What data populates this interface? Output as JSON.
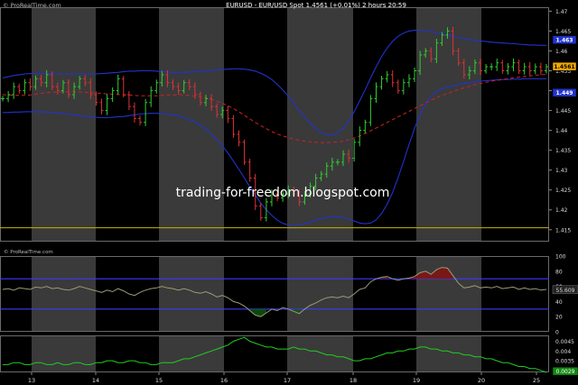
{
  "header": {
    "source_label": "© ProRealTime.com",
    "title": "EURUSD - EUR/USD Spot    1.4561 (+0.01%)    2 hours  20:59"
  },
  "watermark": "trading-for-freedom.blogspot.com",
  "price_axis": {
    "ticks": [
      "1.47",
      "1.465",
      "1.46",
      "1.455",
      "1.45",
      "1.445",
      "1.44",
      "1.435",
      "1.43",
      "1.425",
      "1.42",
      "1.415"
    ],
    "last_price": "1.4561",
    "upper_band_label": "1.463",
    "lower_band_label": "1.449"
  },
  "rsi_axis": {
    "ticks": [
      "100",
      "80",
      "60",
      "40",
      "20",
      "0"
    ],
    "current_value": "55.609"
  },
  "volatility_axis": {
    "ticks": [
      "0.0045",
      "0.004",
      "0.0035"
    ],
    "current_value": "0.0029"
  },
  "x_axis": {
    "ticks": [
      "13",
      "14",
      "15",
      "16",
      "17",
      "18",
      "19",
      "20",
      "21",
      "22",
      "23",
      "24",
      "25"
    ]
  },
  "colors": {
    "bg_night": "#000000",
    "bg_day": "#3a3a3a",
    "candle_up": "#33cc33",
    "candle_down": "#dd3333",
    "bollinger": "#2233cc",
    "moving_avg": "#cc2222",
    "support_line": "#c8b400",
    "rsi_line": "#9a9a7a",
    "rsi_levels": "#3a3aff",
    "volatility": "#22cc22",
    "last_price_badge": "#f2a800"
  },
  "chart_data": [
    {
      "type": "candlestick",
      "title": "EURUSD - EUR/USD Spot",
      "ylim": [
        1.412,
        1.471
      ],
      "x_ticks": [
        "13",
        "14",
        "15",
        "16",
        "17",
        "18",
        "19",
        "20",
        "21",
        "22",
        "23",
        "24",
        "25"
      ],
      "close": [
        1.448,
        1.449,
        1.451,
        1.45,
        1.452,
        1.451,
        1.453,
        1.452,
        1.454,
        1.451,
        1.45,
        1.452,
        1.449,
        1.451,
        1.453,
        1.452,
        1.449,
        1.447,
        1.445,
        1.448,
        1.45,
        1.453,
        1.449,
        1.446,
        1.443,
        1.442,
        1.447,
        1.45,
        1.452,
        1.454,
        1.452,
        1.451,
        1.45,
        1.452,
        1.451,
        1.449,
        1.447,
        1.448,
        1.446,
        1.444,
        1.445,
        1.443,
        1.439,
        1.437,
        1.432,
        1.428,
        1.421,
        1.418,
        1.422,
        1.424,
        1.423,
        1.424,
        1.425,
        1.424,
        1.422,
        1.424,
        1.426,
        1.428,
        1.429,
        1.431,
        1.432,
        1.432,
        1.434,
        1.433,
        1.437,
        1.44,
        1.442,
        1.448,
        1.451,
        1.453,
        1.454,
        1.452,
        1.45,
        1.452,
        1.453,
        1.455,
        1.459,
        1.46,
        1.458,
        1.462,
        1.464,
        1.465,
        1.46,
        1.457,
        1.454,
        1.455,
        1.457,
        1.455,
        1.456,
        1.456,
        1.457,
        1.455,
        1.456,
        1.457,
        1.455,
        1.456,
        1.455,
        1.456,
        1.455,
        1.456
      ],
      "bollinger_upper": [
        1.4532,
        1.4535,
        1.4538,
        1.454,
        1.4542,
        1.4543,
        1.4543,
        1.4543,
        1.4543,
        1.4543,
        1.4542,
        1.4542,
        1.4542,
        1.4542,
        1.4542,
        1.4542,
        1.4542,
        1.4542,
        1.4543,
        1.4544,
        1.4545,
        1.4546,
        1.4548,
        1.4549,
        1.4549,
        1.455,
        1.455,
        1.455,
        1.4549,
        1.4548,
        1.4547,
        1.4546,
        1.4546,
        1.4546,
        1.4547,
        1.4548,
        1.4549,
        1.455,
        1.4551,
        1.4552,
        1.4553,
        1.4554,
        1.4555,
        1.4555,
        1.4554,
        1.4552,
        1.4549,
        1.4544,
        1.4537,
        1.4528,
        1.4516,
        1.4502,
        1.4486,
        1.4468,
        1.445,
        1.4433,
        1.4418,
        1.4405,
        1.4395,
        1.4389,
        1.4388,
        1.4394,
        1.4406,
        1.4424,
        1.4447,
        1.4474,
        1.4502,
        1.4532,
        1.456,
        1.4586,
        1.4607,
        1.4624,
        1.4637,
        1.4645,
        1.465,
        1.4652,
        1.4652,
        1.4651,
        1.4649,
        1.4646,
        1.4643,
        1.464,
        1.4637,
        1.4634,
        1.4631,
        1.4629,
        1.4627,
        1.4625,
        1.4624,
        1.4622,
        1.4621,
        1.462,
        1.4619,
        1.4618,
        1.4617,
        1.4616,
        1.4615,
        1.4615,
        1.4614,
        1.4614
      ],
      "bollinger_lower": [
        1.4445,
        1.4445,
        1.4446,
        1.4446,
        1.4447,
        1.4447,
        1.4447,
        1.4447,
        1.4446,
        1.4445,
        1.4444,
        1.4443,
        1.4441,
        1.4439,
        1.4437,
        1.4435,
        1.4434,
        1.4433,
        1.4432,
        1.4432,
        1.4433,
        1.4434,
        1.4435,
        1.4437,
        1.4439,
        1.4441,
        1.4442,
        1.4443,
        1.4443,
        1.4442,
        1.4441,
        1.4439,
        1.4436,
        1.4432,
        1.4427,
        1.4421,
        1.4413,
        1.4403,
        1.4391,
        1.4377,
        1.4361,
        1.4343,
        1.4323,
        1.4302,
        1.428,
        1.4258,
        1.4237,
        1.4217,
        1.42,
        1.4186,
        1.4174,
        1.4166,
        1.4162,
        1.416,
        1.4162,
        1.4165,
        1.4169,
        1.4174,
        1.4178,
        1.4181,
        1.4183,
        1.4183,
        1.4181,
        1.4177,
        1.4172,
        1.4167,
        1.4165,
        1.4167,
        1.4175,
        1.4191,
        1.4214,
        1.4244,
        1.4281,
        1.4322,
        1.4365,
        1.4405,
        1.444,
        1.4467,
        1.4486,
        1.4498,
        1.4505,
        1.4509,
        1.4512,
        1.4515,
        1.4518,
        1.452,
        1.4522,
        1.4524,
        1.4525,
        1.4526,
        1.4527,
        1.4528,
        1.4528,
        1.4529,
        1.4529,
        1.453,
        1.453,
        1.453,
        1.453,
        1.453
      ],
      "moving_average": [
        1.449,
        1.4489,
        1.4488,
        1.4488,
        1.4488,
        1.4489,
        1.4491,
        1.4493,
        1.4495,
        1.4496,
        1.4497,
        1.4497,
        1.4497,
        1.4497,
        1.4497,
        1.4496,
        1.4495,
        1.4494,
        1.4493,
        1.4492,
        1.4491,
        1.449,
        1.4489,
        1.4489,
        1.4488,
        1.4487,
        1.4487,
        1.4487,
        1.4487,
        1.4488,
        1.4489,
        1.4489,
        1.449,
        1.4489,
        1.4488,
        1.4486,
        1.4484,
        1.4481,
        1.4478,
        1.4473,
        1.4468,
        1.4462,
        1.4455,
        1.4447,
        1.4438,
        1.4429,
        1.442,
        1.4412,
        1.4404,
        1.4397,
        1.4391,
        1.4386,
        1.4382,
        1.4378,
        1.4375,
        1.4373,
        1.4371,
        1.437,
        1.4369,
        1.4369,
        1.437,
        1.4371,
        1.4373,
        1.4376,
        1.4381,
        1.4386,
        1.4392,
        1.4399,
        1.4406,
        1.4413,
        1.442,
        1.4427,
        1.4434,
        1.4441,
        1.4448,
        1.4455,
        1.4462,
        1.4469,
        1.4476,
        1.4482,
        1.4488,
        1.4493,
        1.4498,
        1.4503,
        1.4507,
        1.4511,
        1.4515,
        1.4518,
        1.4521,
        1.4524,
        1.4526,
        1.4528,
        1.453,
        1.4532,
        1.4534,
        1.4536,
        1.4537,
        1.4539,
        1.454,
        1.4541
      ],
      "support_level": 1.4155
    },
    {
      "type": "line",
      "title": "RSI",
      "ylim": [
        0,
        100
      ],
      "levels": [
        70,
        30
      ],
      "values": [
        56,
        57,
        55,
        58,
        57,
        56,
        59,
        58,
        60,
        57,
        58,
        56,
        55,
        57,
        60,
        58,
        56,
        54,
        52,
        55,
        53,
        57,
        54,
        50,
        48,
        52,
        55,
        57,
        58,
        60,
        58,
        57,
        55,
        57,
        55,
        52,
        51,
        53,
        50,
        46,
        48,
        45,
        40,
        38,
        34,
        28,
        22,
        20,
        25,
        30,
        28,
        32,
        30,
        27,
        24,
        30,
        35,
        38,
        42,
        45,
        46,
        45,
        47,
        45,
        50,
        56,
        58,
        66,
        70,
        72,
        73,
        70,
        68,
        70,
        71,
        73,
        78,
        80,
        76,
        82,
        85,
        84,
        74,
        64,
        58,
        59,
        61,
        58,
        59,
        58,
        60,
        57,
        58,
        59,
        56,
        58,
        56,
        57,
        55,
        56
      ]
    },
    {
      "type": "line",
      "title": "Volatility",
      "ylim": [
        0.0029,
        0.0048
      ],
      "values": [
        0.0033,
        0.0033,
        0.0034,
        0.0034,
        0.0033,
        0.0033,
        0.0034,
        0.0034,
        0.0033,
        0.0033,
        0.0034,
        0.0033,
        0.0033,
        0.0034,
        0.0034,
        0.0033,
        0.0033,
        0.0034,
        0.0034,
        0.0035,
        0.0035,
        0.0034,
        0.0034,
        0.0035,
        0.0035,
        0.0034,
        0.0034,
        0.0033,
        0.0033,
        0.0034,
        0.0034,
        0.0034,
        0.0035,
        0.0036,
        0.0036,
        0.0037,
        0.0038,
        0.0039,
        0.004,
        0.0041,
        0.0042,
        0.0043,
        0.0045,
        0.0046,
        0.0047,
        0.0045,
        0.0044,
        0.0043,
        0.0042,
        0.0042,
        0.0041,
        0.0041,
        0.0041,
        0.0042,
        0.0041,
        0.0041,
        0.004,
        0.004,
        0.0039,
        0.0038,
        0.0038,
        0.0037,
        0.0037,
        0.0036,
        0.0035,
        0.0035,
        0.0036,
        0.0036,
        0.0037,
        0.0038,
        0.0039,
        0.0039,
        0.004,
        0.004,
        0.0041,
        0.0041,
        0.0042,
        0.0042,
        0.0041,
        0.0041,
        0.004,
        0.004,
        0.0039,
        0.0039,
        0.0038,
        0.0038,
        0.0037,
        0.0037,
        0.0036,
        0.0036,
        0.0035,
        0.0034,
        0.0034,
        0.0033,
        0.0032,
        0.0032,
        0.0031,
        0.0031,
        0.003,
        0.0029
      ]
    }
  ]
}
